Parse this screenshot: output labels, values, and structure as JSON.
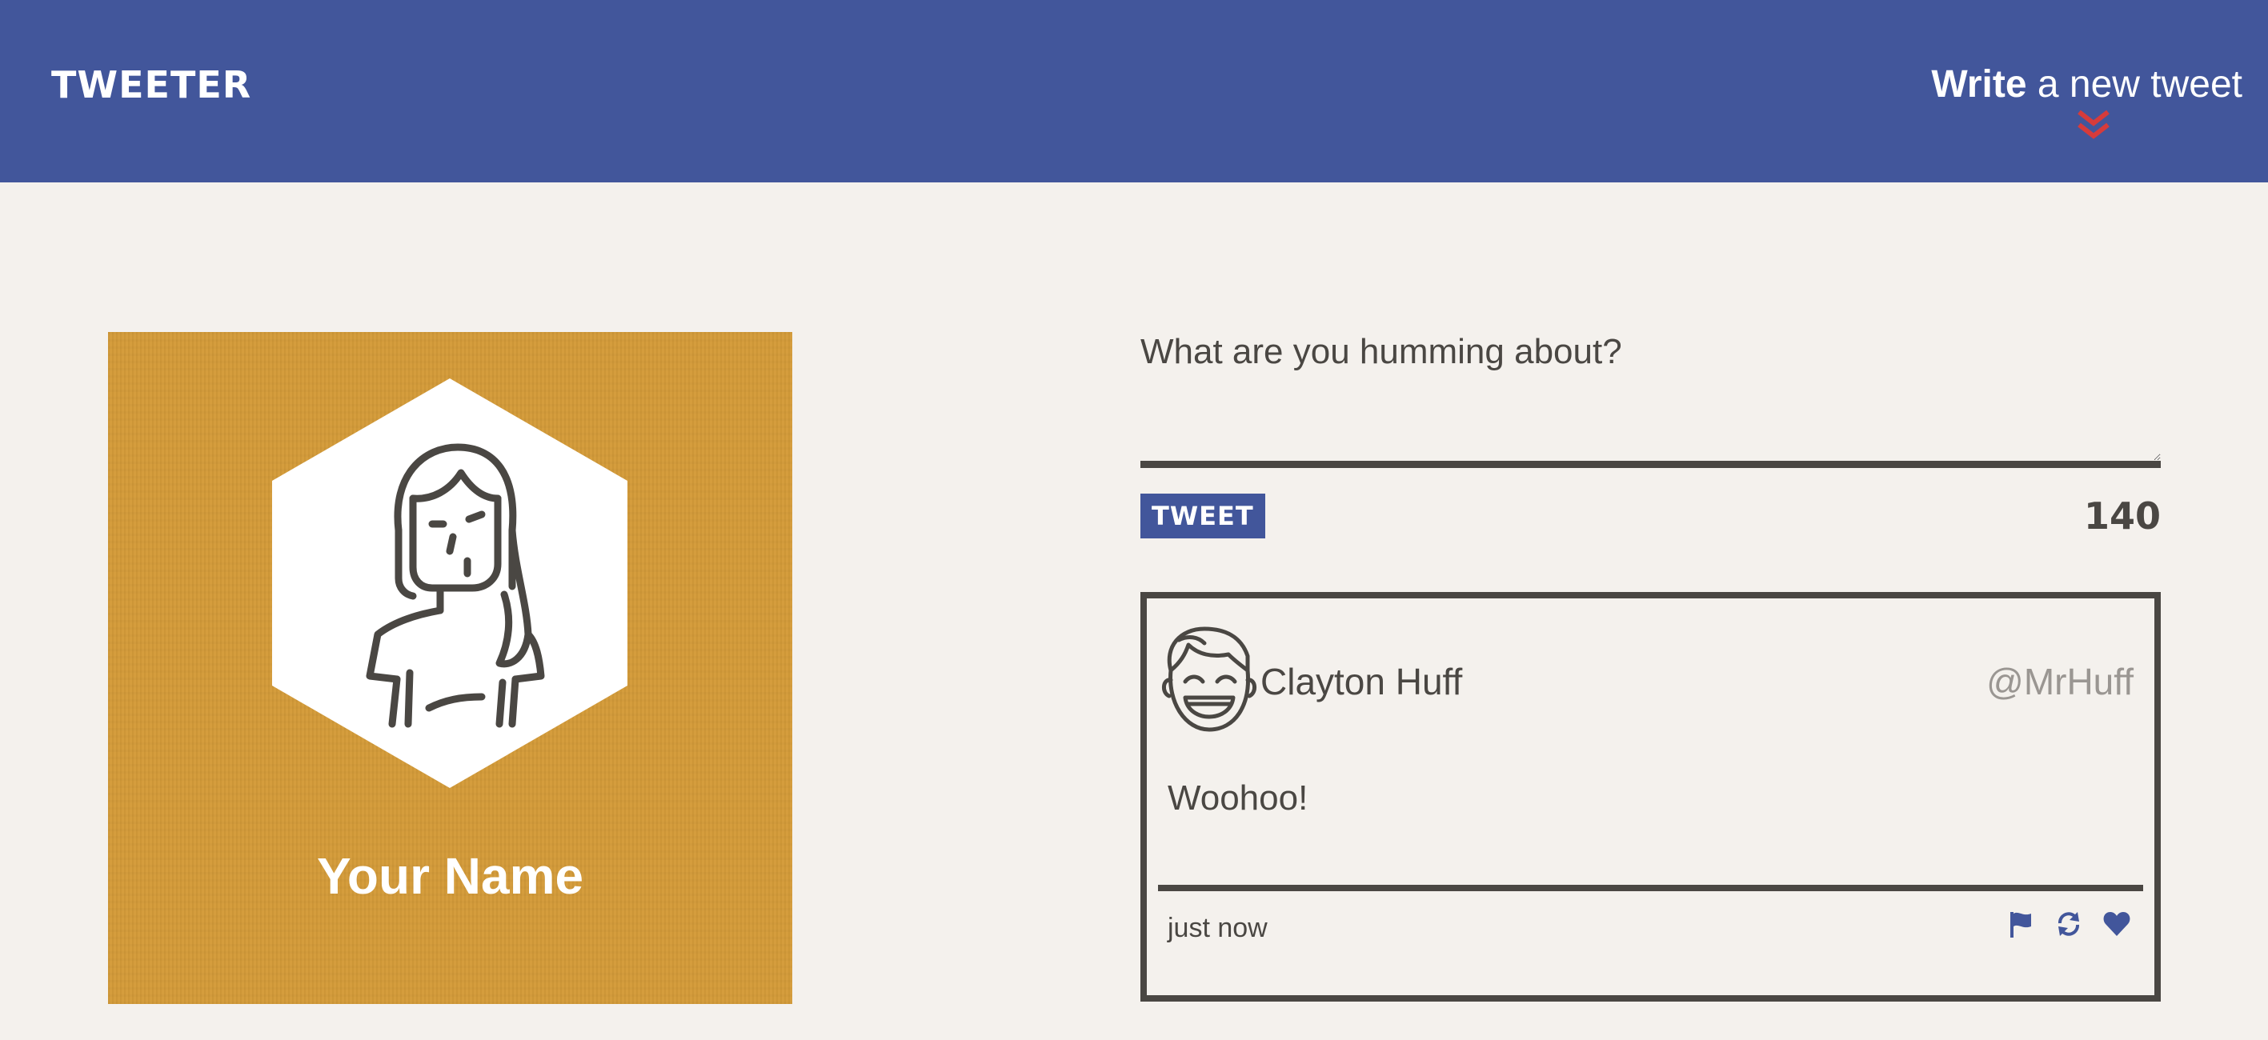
{
  "nav": {
    "brand": "TWEETER",
    "compose_toggle_strong": "Write",
    "compose_toggle_rest": " a new tweet",
    "accent_color": "#d63b3b",
    "nav_color": "#42569b"
  },
  "profile": {
    "name": "Your Name",
    "background_color": "#d49b39",
    "avatar_icon": "woman-avatar-icon"
  },
  "composer": {
    "placeholder": "What are you humming about?",
    "value": "",
    "submit_label": "TWEET",
    "counter": "140"
  },
  "tweets": [
    {
      "avatar_icon": "smiling-man-avatar-icon",
      "name": "Clayton Huff",
      "handle": "@MrHuff",
      "content": "Woohoo!",
      "time": "just now",
      "actions": [
        "flag-icon",
        "retweet-icon",
        "heart-icon"
      ],
      "action_color": "#42569b"
    }
  ]
}
